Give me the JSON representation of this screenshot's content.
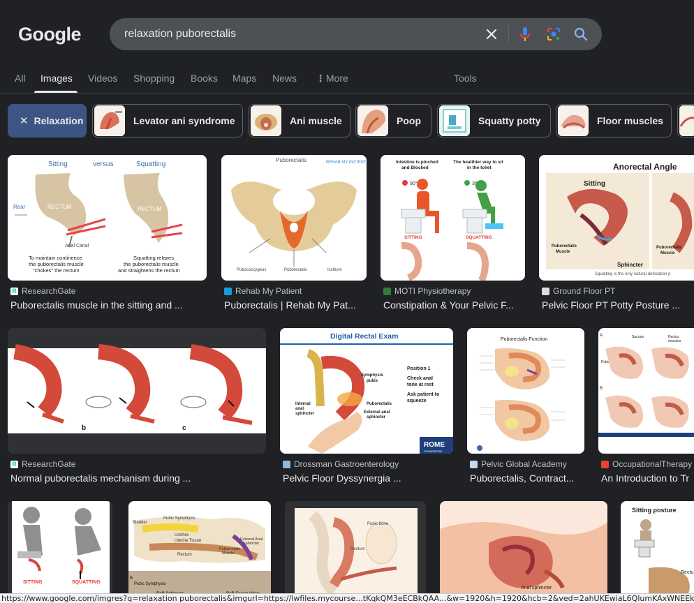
{
  "logo": "Google",
  "search": {
    "query": "relaxation puborectalis"
  },
  "tabs": [
    {
      "label": "All"
    },
    {
      "label": "Images"
    },
    {
      "label": "Videos"
    },
    {
      "label": "Shopping"
    },
    {
      "label": "Books"
    },
    {
      "label": "Maps"
    },
    {
      "label": "News"
    },
    {
      "label": "More"
    }
  ],
  "tools_label": "Tools",
  "chips": [
    {
      "label": "Relaxation",
      "selected": true
    },
    {
      "label": "Levator ani syndrome"
    },
    {
      "label": "Ani muscle"
    },
    {
      "label": "Poop"
    },
    {
      "label": "Squatty potty"
    },
    {
      "label": "Floor muscles"
    }
  ],
  "results": [
    {
      "source": "ResearchGate",
      "title": "Puborectalis muscle in the sitting and ...",
      "image_text": {
        "sitting": "Sitting",
        "versus": "versus",
        "squatting": "Squatting",
        "rear": "Rear",
        "rectum": "RECTUM",
        "anal_canal": "Anal Canal",
        "caption_left": [
          "To maintain continence",
          "the puborectalis muscle",
          "\"chokes\" the rectum"
        ],
        "caption_right": [
          "Squatting relaxes",
          "the puborectalis muscle",
          "and straightens the rectum"
        ]
      }
    },
    {
      "source": "Rehab My Patient",
      "title": "Puborectalis | Rehab My Pat...",
      "image_text": {
        "top": "Puborectalis",
        "brand": "REHAB MY PATIENT",
        "l1": "Pubococcygeus",
        "l2": "Puborectalis",
        "l3": "Ischium"
      }
    },
    {
      "source": "MOTI Physiotherapy",
      "title": "Constipation & Your Pelvic F...",
      "image_text": {
        "left_head": [
          "Intestine is pinched",
          "and Blocked"
        ],
        "right_head": [
          "The healthier way to sit",
          "in the toilet"
        ],
        "left_angle": "90°",
        "right_angle": "35°",
        "sitting": "SITTING",
        "squatting": "SQUATTING"
      }
    },
    {
      "source": "Ground Floor PT",
      "title": "Pelvic Floor PT Potty Posture ...",
      "image_text": {
        "title": "Anorectal Angle",
        "sitting": "Sitting",
        "pr1": [
          "Puborectalis",
          "Muscle"
        ],
        "pr2": [
          "Puborectalis",
          "Muscle"
        ],
        "sphincter": "Sphincter",
        "caption": "Squatting is the only natural defecation p"
      }
    },
    {
      "source": "ResearchGate",
      "title": "Normal puborectalis mechanism during ...",
      "image_text": {
        "b": "b",
        "c": "c"
      }
    },
    {
      "source": "Drossman Gastroenterology",
      "title": "Pelvic Floor Dyssynergia ...",
      "image_text": {
        "title": "Digital Rectal Exam",
        "symphysis": [
          "Symphysis",
          "pubis"
        ],
        "position": "Position 1",
        "check": [
          "Check anal",
          "tone at rest"
        ],
        "ask": [
          "Ask patient to",
          "squeeze"
        ],
        "puborectalis": "Puborectalis",
        "internal": [
          "Internal",
          "anal",
          "sphincter"
        ],
        "external": [
          "External anal",
          "sphincter"
        ],
        "rome": "ROME",
        "foundation": "FOUNDATION"
      }
    },
    {
      "source": "Pelvic Global Academy",
      "title": "Puborectalis, Contract...",
      "image_text": {
        "title": "Puborectalis Function"
      }
    },
    {
      "source": "OccupationalTherapy",
      "title": "An Introduction to Tr",
      "image_text": {
        "a": "A",
        "b": "B",
        "sacrum": "Sacrum",
        "rectus": [
          "Rectus",
          "muscles"
        ],
        "pubis": "Pubis"
      }
    },
    {
      "image_text": {
        "sitting": "SITTING",
        "squatting": "SQUATTING"
      }
    },
    {
      "image_text": {
        "bladder": "Bladder",
        "pubic": "Pubic Symphysis",
        "urethra": "Urethra",
        "uterine": "Uterine Tissue",
        "rectum": "Rectum",
        "pr": [
          "Puborectalis",
          "Muscle"
        ],
        "ext": [
          "External Anal",
          "Sphincter"
        ],
        "pubic2": "Pubic Symphysis",
        "b": "B",
        "rnb": "RnB Sphincter",
        "rnb2": "RnB Facing Wires"
      }
    },
    {
      "image_text": {
        "pubic_bone": "Pubic bone",
        "rectum": "Rectum"
      }
    },
    {
      "image_text": {
        "anal": "Anal sphincter"
      }
    },
    {
      "image_text": {
        "title": "Sitting posture",
        "rectu": "Rectu"
      }
    }
  ],
  "status_url": "https://www.google.com/imgres?q=relaxation puborectalis&imgurl=https://lwfiles.mycourse...tKqkQM3eECBkQAA...&w=1920&h=1920&hcb=2&ved=2ahUKEwiaL6QlumKAxWNEEkFHVxh"
}
